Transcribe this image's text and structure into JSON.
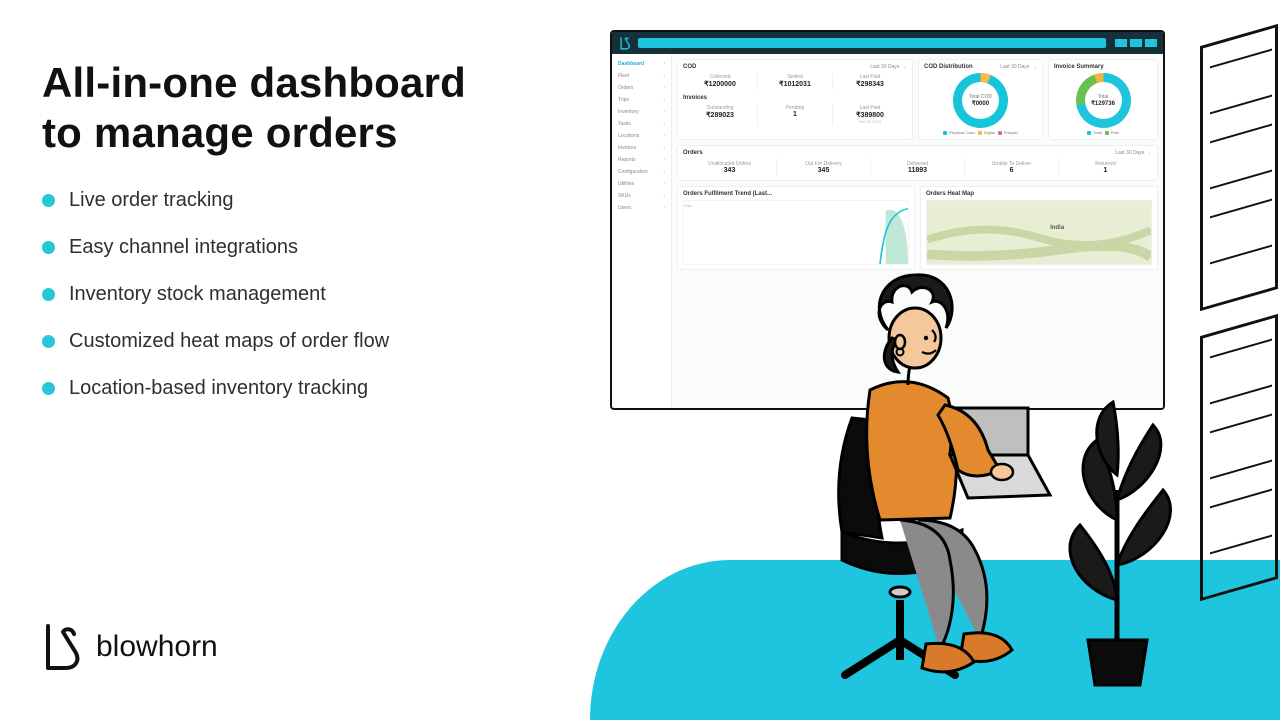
{
  "headline_line1": "All-in-one dashboard",
  "headline_line2": "to manage orders",
  "features": [
    "Live order tracking",
    "Easy channel integrations",
    "Inventory stock management",
    "Customized heat maps of order flow",
    "Location-based inventory tracking"
  ],
  "brand": "blowhorn",
  "dashboard": {
    "sidebar": {
      "items": [
        "Dashboard",
        "Fleet",
        "Orders",
        "Trips",
        "Inventory",
        "Tasks",
        "Locations",
        "Invoices",
        "Reports",
        "Configuration",
        "Utilities",
        "SKUs",
        "Users"
      ],
      "active_index": 0
    },
    "filter_last30": "Last 30 Days",
    "cod": {
      "title": "COD",
      "collected_label": "Collected",
      "collected_value": "₹1200000",
      "settled_label": "Settled",
      "settled_value": "₹1012031",
      "lastpaid_label": "Last Paid",
      "lastpaid_value": "₹298343"
    },
    "invoices": {
      "title": "Invoices",
      "outstanding_label": "Outstanding",
      "outstanding_value": "₹289023",
      "pending_label": "Pending",
      "pending_value": "1",
      "lastpaid_label": "Last Paid",
      "lastpaid_value": "₹389800",
      "lastpaid_sub": "Feb 02 2022"
    },
    "cod_dist": {
      "title": "COD Distribution",
      "center_label": "Total COD",
      "center_value": "₹0000",
      "legend": [
        {
          "label": "Physical Cash",
          "color": "#17C4DA"
        },
        {
          "label": "Digital",
          "color": "#FFB648"
        },
        {
          "label": "Prepaid",
          "color": "#E86D6D"
        }
      ]
    },
    "inv_summary": {
      "title": "Invoice Summary",
      "center_label": "Total",
      "center_value": "₹129736",
      "legend": [
        {
          "label": "Total",
          "color": "#1FC4DF"
        },
        {
          "label": "Paid",
          "color": "#6AC04F"
        }
      ]
    },
    "orders": {
      "title": "Orders",
      "filter": "Last 30 Days",
      "items": [
        {
          "label": "Unallocated Orders",
          "value": "343"
        },
        {
          "label": "Out For Delivery",
          "value": "345"
        },
        {
          "label": "Delivered",
          "value": "11893"
        },
        {
          "label": "Unable To Deliver",
          "value": "6"
        },
        {
          "label": "Returned",
          "value": "1"
        }
      ]
    },
    "trend": {
      "title": "Orders Fulfilment Trend (Last...",
      "ylabel": "Kilo"
    },
    "heatmap": {
      "title": "Orders Heat Map",
      "country": "India"
    }
  }
}
